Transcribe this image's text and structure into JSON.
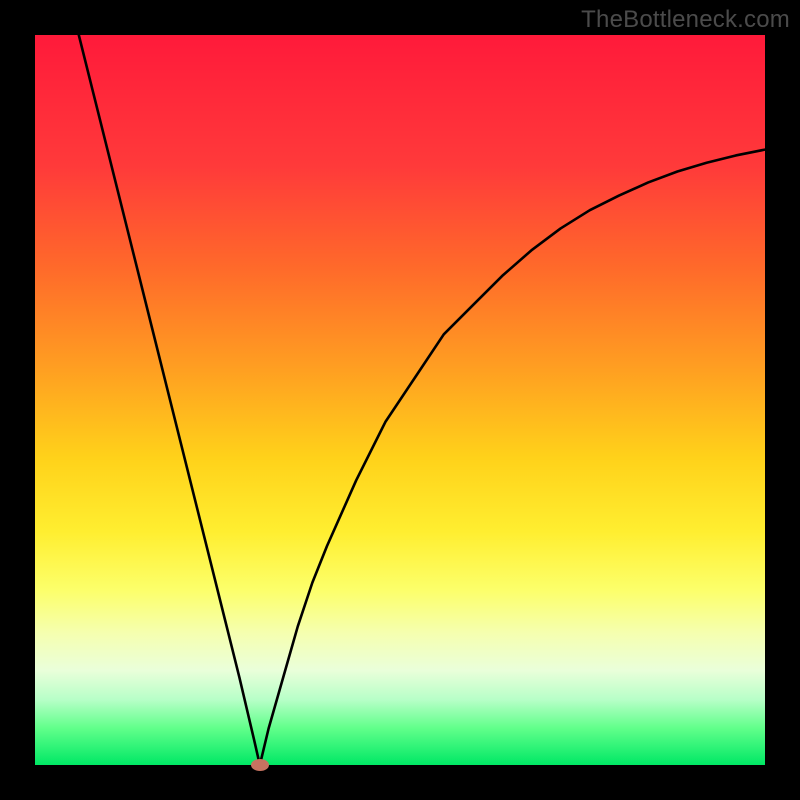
{
  "watermark": "TheBottleneck.com",
  "chart_data": {
    "type": "line",
    "title": "",
    "xlabel": "",
    "ylabel": "",
    "xlim": [
      0,
      100
    ],
    "ylim": [
      0,
      100
    ],
    "x": [
      6,
      8,
      10,
      12,
      14,
      16,
      18,
      20,
      22,
      24,
      26,
      28,
      30,
      30.8,
      32,
      34,
      36,
      38,
      40,
      44,
      48,
      52,
      56,
      60,
      64,
      68,
      72,
      76,
      80,
      84,
      88,
      92,
      96,
      100
    ],
    "y": [
      100,
      92,
      84,
      76,
      68,
      60,
      52,
      44,
      36,
      28,
      20,
      12,
      3.5,
      0,
      5,
      12,
      19,
      25,
      30,
      39,
      47,
      53,
      59,
      63,
      67,
      70.5,
      73.5,
      76,
      78,
      79.8,
      81.3,
      82.5,
      83.5,
      84.3
    ],
    "marker": {
      "x": 30.8,
      "y": 0
    },
    "grid": false,
    "legend": false
  },
  "colors": {
    "curve": "#000000",
    "marker": "#c77361",
    "frame": "#000000"
  }
}
